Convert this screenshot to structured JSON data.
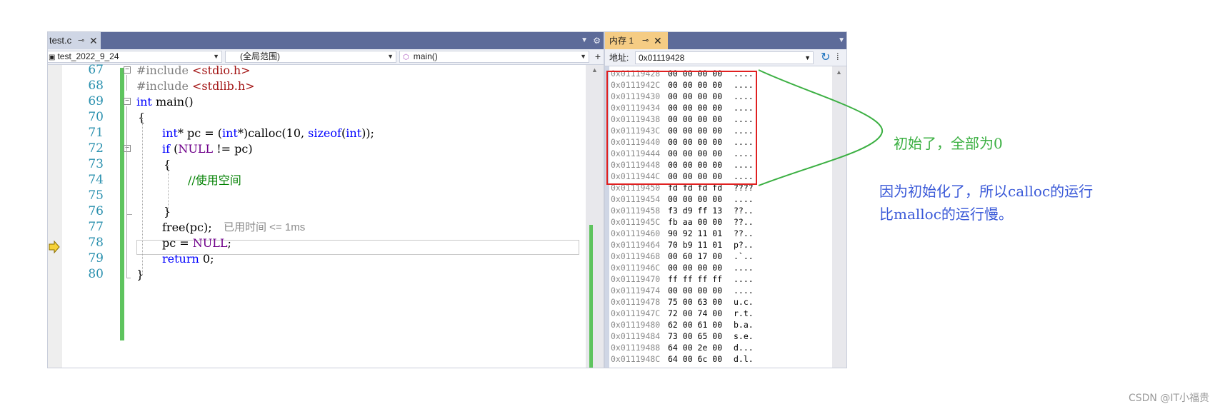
{
  "editor": {
    "tab": {
      "label": "test.c",
      "pin": "⊸",
      "close": "✕"
    },
    "tab_dropdown": "▼",
    "tab_gear": "⚙",
    "nav": {
      "project": "test_2022_9_24",
      "scope": "(全局范围)",
      "function": "main()",
      "dropdown": "▼",
      "split": "+"
    },
    "lines": [
      {
        "num": "67",
        "code": "#include <stdio.h>"
      },
      {
        "num": "68",
        "code": "#include <stdlib.h>"
      },
      {
        "num": "69",
        "code": "int main()"
      },
      {
        "num": "70",
        "code": "{"
      },
      {
        "num": "71",
        "code": "int* pc = (int*)calloc(10, sizeof(int));"
      },
      {
        "num": "72",
        "code": "if (NULL != pc)"
      },
      {
        "num": "73",
        "code": "{"
      },
      {
        "num": "74",
        "code": "//使用空间"
      },
      {
        "num": "75",
        "code": ""
      },
      {
        "num": "76",
        "code": "}"
      },
      {
        "num": "77",
        "code": "free(pc);"
      },
      {
        "num": "78",
        "code": "pc = NULL;"
      },
      {
        "num": "79",
        "code": "return 0;"
      },
      {
        "num": "80",
        "code": "}"
      }
    ],
    "perf_tip": "已用时间 <= 1ms",
    "current_line": "77"
  },
  "memory": {
    "tab": {
      "label": "内存 1",
      "pin": "⊸",
      "close": "✕"
    },
    "tab_dropdown": "▼",
    "address_label": "地址:",
    "address_value": "0x01119428",
    "address_dropdown": "▼",
    "refresh": "↻",
    "more": "⁞",
    "rows": [
      {
        "addr": "0x01119428",
        "hex": "00 00 00 00",
        "ascii": "...."
      },
      {
        "addr": "0x0111942C",
        "hex": "00 00 00 00",
        "ascii": "...."
      },
      {
        "addr": "0x01119430",
        "hex": "00 00 00 00",
        "ascii": "...."
      },
      {
        "addr": "0x01119434",
        "hex": "00 00 00 00",
        "ascii": "...."
      },
      {
        "addr": "0x01119438",
        "hex": "00 00 00 00",
        "ascii": "...."
      },
      {
        "addr": "0x0111943C",
        "hex": "00 00 00 00",
        "ascii": "...."
      },
      {
        "addr": "0x01119440",
        "hex": "00 00 00 00",
        "ascii": "...."
      },
      {
        "addr": "0x01119444",
        "hex": "00 00 00 00",
        "ascii": "...."
      },
      {
        "addr": "0x01119448",
        "hex": "00 00 00 00",
        "ascii": "...."
      },
      {
        "addr": "0x0111944C",
        "hex": "00 00 00 00",
        "ascii": "...."
      },
      {
        "addr": "0x01119450",
        "hex": "fd fd fd fd",
        "ascii": "????"
      },
      {
        "addr": "0x01119454",
        "hex": "00 00 00 00",
        "ascii": "...."
      },
      {
        "addr": "0x01119458",
        "hex": "f3 d9 ff 13",
        "ascii": "??.."
      },
      {
        "addr": "0x0111945C",
        "hex": "fb aa 00 00",
        "ascii": "??.."
      },
      {
        "addr": "0x01119460",
        "hex": "90 92 11 01",
        "ascii": "??.."
      },
      {
        "addr": "0x01119464",
        "hex": "70 b9 11 01",
        "ascii": "p?.."
      },
      {
        "addr": "0x01119468",
        "hex": "00 60 17 00",
        "ascii": ".`.."
      },
      {
        "addr": "0x0111946C",
        "hex": "00 00 00 00",
        "ascii": "...."
      },
      {
        "addr": "0x01119470",
        "hex": "ff ff ff ff",
        "ascii": "...."
      },
      {
        "addr": "0x01119474",
        "hex": "00 00 00 00",
        "ascii": "...."
      },
      {
        "addr": "0x01119478",
        "hex": "75 00 63 00",
        "ascii": "u.c."
      },
      {
        "addr": "0x0111947C",
        "hex": "72 00 74 00",
        "ascii": "r.t."
      },
      {
        "addr": "0x01119480",
        "hex": "62 00 61 00",
        "ascii": "b.a."
      },
      {
        "addr": "0x01119484",
        "hex": "73 00 65 00",
        "ascii": "s.e."
      },
      {
        "addr": "0x01119488",
        "hex": "64 00 2e 00",
        "ascii": "d..."
      },
      {
        "addr": "0x0111948C",
        "hex": "64 00 6c 00",
        "ascii": "d.l."
      }
    ]
  },
  "annotations": {
    "green_note": "初始了，全部为0",
    "blue_note_line1": "因为初始化了，所以calloc的运行",
    "blue_note_line2": "比malloc的运行慢。"
  },
  "watermark": "CSDN @IT小福贵",
  "colors": {
    "tabbar": "#5d6b99",
    "memory_tab": "#f5cc84",
    "line_numbers": "#2b91af",
    "keyword": "#0000ff",
    "include_path": "#a31515",
    "comment": "#008000",
    "change_bar": "#5ec45e",
    "highlight_box": "#e02020",
    "green_annotation": "#3cb043",
    "blue_annotation": "#3b5ad8"
  }
}
